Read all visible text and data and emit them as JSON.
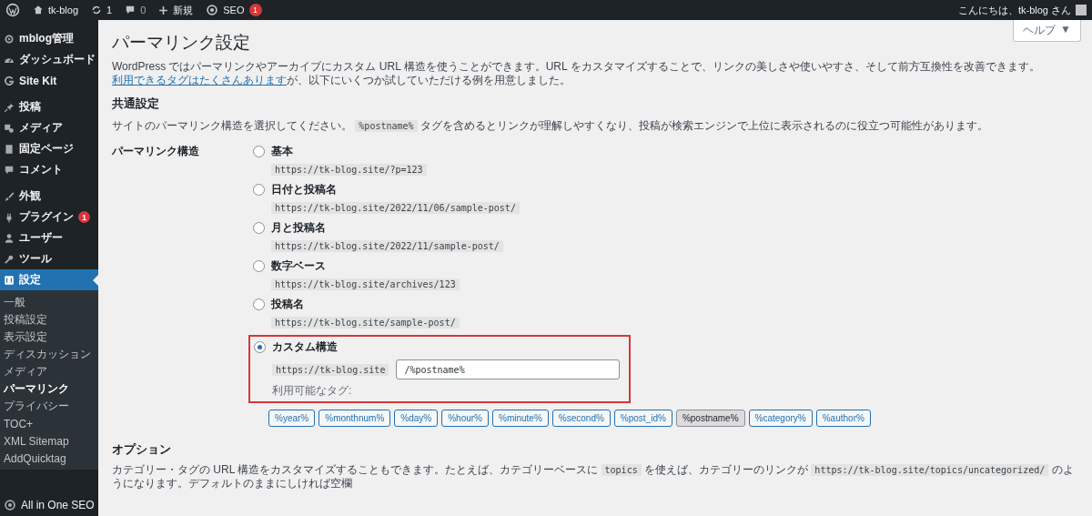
{
  "admin_bar": {
    "site": "tk-blog",
    "updates": "1",
    "comments": "0",
    "new": "新規",
    "seo": "SEO",
    "seo_badge": "1",
    "greeting": "こんにちは、tk-blog さん"
  },
  "sidebar": {
    "groups": [
      [
        {
          "label": "mblog管理",
          "selected": false
        },
        {
          "label": "ダッシュボード",
          "selected": false
        },
        {
          "label": "Site Kit",
          "selected": false
        }
      ],
      [
        {
          "label": "投稿",
          "selected": false
        },
        {
          "label": "メディア",
          "selected": false
        },
        {
          "label": "固定ページ",
          "selected": false
        },
        {
          "label": "コメント",
          "selected": false
        }
      ],
      [
        {
          "label": "外観",
          "selected": false
        },
        {
          "label": "プラグイン",
          "badge": "1",
          "selected": false
        },
        {
          "label": "ユーザー",
          "selected": false
        },
        {
          "label": "ツール",
          "selected": false
        },
        {
          "label": "設定",
          "selected": true
        }
      ]
    ],
    "submenu": [
      {
        "label": "一般",
        "selected": false
      },
      {
        "label": "投稿設定",
        "selected": false
      },
      {
        "label": "表示設定",
        "selected": false
      },
      {
        "label": "ディスカッション",
        "selected": false
      },
      {
        "label": "メディア",
        "selected": false
      },
      {
        "label": "パーマリンク",
        "selected": true
      },
      {
        "label": "プライバシー",
        "selected": false
      },
      {
        "label": "TOC+",
        "selected": false
      },
      {
        "label": "XML Sitemap",
        "selected": false
      },
      {
        "label": "AddQuicktag",
        "selected": false
      }
    ],
    "footer_item": {
      "label": "All in One SEO",
      "selected": false
    }
  },
  "help": {
    "label": "ヘルプ",
    "caret": "▼"
  },
  "title": "パーマリンク設定",
  "intro": {
    "before": "WordPress ではパーマリンクやアーカイブにカスタム URL 構造を使うことができます。URL をカスタマイズすることで、リンクの美しさや使いやすさ、そして前方互換性を改善できます。",
    "link": "利用できるタグはたくさんあります",
    "after": "が、以下にいくつか試していただける例を用意しました。"
  },
  "common": {
    "heading": "共通設定",
    "before": "サイトのパーマリンク構造を選択してください。",
    "code": "%postname%",
    "after": "タグを含めるとリンクが理解しやすくなり、投稿が検索エンジンで上位に表示されるのに役立つ可能性があります。"
  },
  "structure_label": "パーマリンク構造",
  "options": [
    {
      "kind": "preset",
      "label": "基本",
      "example": "https://tk-blog.site/?p=123",
      "selected": false
    },
    {
      "kind": "preset",
      "label": "日付と投稿名",
      "example": "https://tk-blog.site/2022/11/06/sample-post/",
      "selected": false
    },
    {
      "kind": "preset",
      "label": "月と投稿名",
      "example": "https://tk-blog.site/2022/11/sample-post/",
      "selected": false
    },
    {
      "kind": "preset",
      "label": "数字ベース",
      "example": "https://tk-blog.site/archives/123",
      "selected": false
    },
    {
      "kind": "preset",
      "label": "投稿名",
      "example": "https://tk-blog.site/sample-post/",
      "selected": false
    },
    {
      "kind": "custom",
      "label": "カスタム構造",
      "prefix": "https://tk-blog.site",
      "value": "/%postname%",
      "tags_label": "利用可能なタグ:",
      "highlighted": true,
      "selected": true
    }
  ],
  "tags": [
    {
      "label": "%year%",
      "selected": false
    },
    {
      "label": "%monthnum%",
      "selected": false
    },
    {
      "label": "%day%",
      "selected": false
    },
    {
      "label": "%hour%",
      "selected": false
    },
    {
      "label": "%minute%",
      "selected": false
    },
    {
      "label": "%second%",
      "selected": false
    },
    {
      "label": "%post_id%",
      "selected": false
    },
    {
      "label": "%postname%",
      "selected": true
    },
    {
      "label": "%category%",
      "selected": false
    },
    {
      "label": "%author%",
      "selected": false
    }
  ],
  "options_section": {
    "heading": "オプション",
    "before": "カテゴリー・タグの URL 構造をカスタマイズすることもできます。たとえば、カテゴリーベースに",
    "code1": "topics",
    "mid": "を使えば、カテゴリーのリンクが",
    "code2": "https://tk-blog.site/topics/uncategorized/",
    "after": "のようになります。デフォルトのままにしければ空欄"
  }
}
